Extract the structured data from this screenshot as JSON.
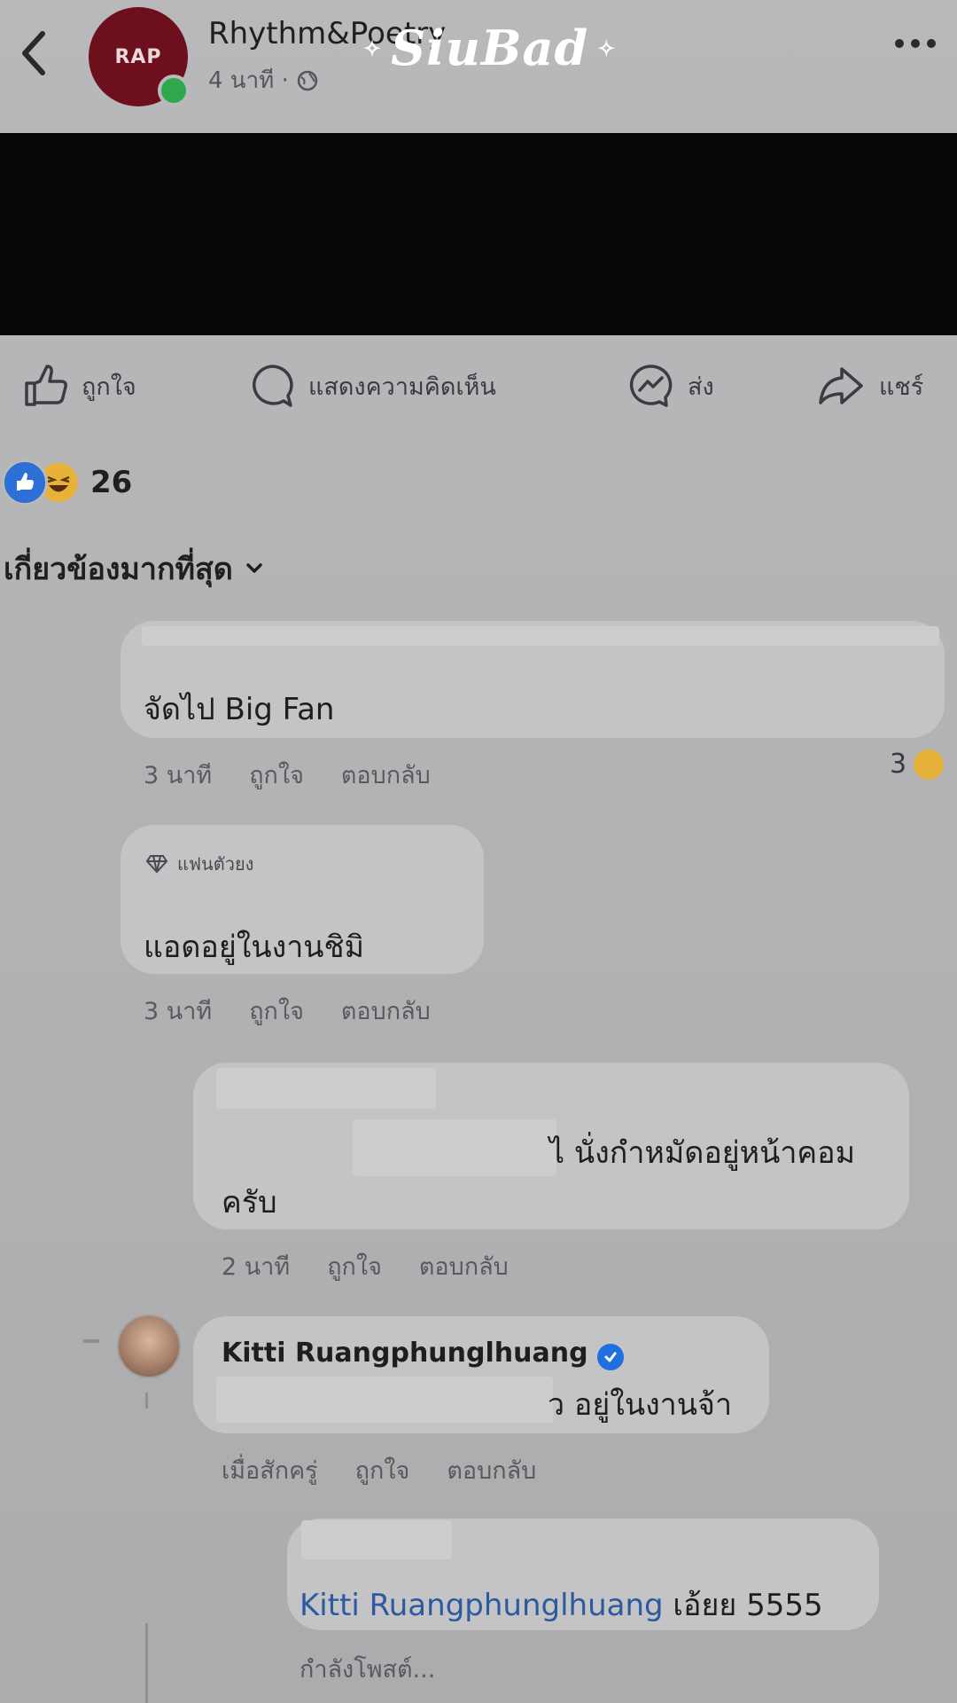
{
  "post": {
    "page_name": "Rhythm&Poetry",
    "avatar_text": "RAP",
    "time": "4 นาที ·",
    "watermark": "SiuBad"
  },
  "actions": {
    "like": "ถูกใจ",
    "comment": "แสดงความคิดเห็น",
    "send": "ส่ง",
    "share": "แชร์"
  },
  "reactions": {
    "count": "26"
  },
  "sort": {
    "label": "เกี่ยวข้องมากที่สุด"
  },
  "comments": [
    {
      "text": "จัดไป Big Fan",
      "time": "3 นาที",
      "like": "ถูกใจ",
      "reply": "ตอบกลับ",
      "reaction_count": "3"
    },
    {
      "badge": "แฟนตัวยง",
      "text": "แอดอยู่ในงานชิมิ",
      "time": "3 นาที",
      "like": "ถูกใจ",
      "reply": "ตอบกลับ"
    },
    {
      "text_line1_tail": "ไ นั่งกำหมัดอยู่หน้าคอม",
      "text_line2": "ครับ",
      "time": "2 นาที",
      "like": "ถูกใจ",
      "reply": "ตอบกลับ"
    },
    {
      "author": "Kitti Ruangphunglhuang",
      "text_tail": "ว อยู่ในงานจ้า",
      "time": "เมื่อสักครู่",
      "like": "ถูกใจ",
      "reply": "ตอบกลับ"
    },
    {
      "mention": "Kitti Ruangphunglhuang",
      "text": " เอ้ยย 5555",
      "status": "กำลังโพสต์..."
    }
  ],
  "colors": {
    "like_blue": "#2c6fd6",
    "haha_yellow": "#e6b23a",
    "verified_blue": "#1e6fe0",
    "mention_blue": "#2c5aa0"
  }
}
